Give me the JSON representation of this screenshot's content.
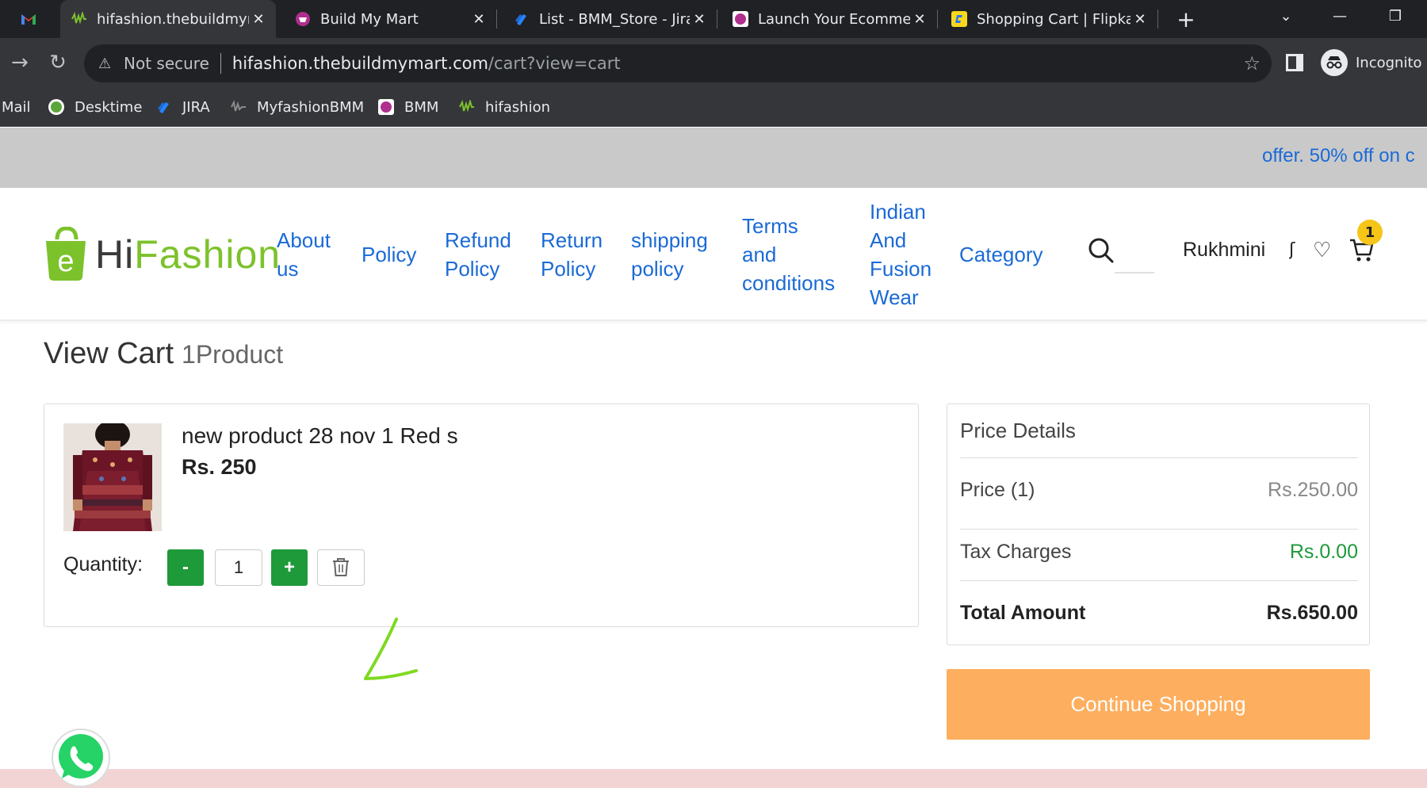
{
  "browser": {
    "tabs": [
      {
        "title": "hifashion.thebuildmymart.com",
        "active": true
      },
      {
        "title": "Build My Mart",
        "active": false
      },
      {
        "title": "List - BMM_Store - Jira",
        "active": false
      },
      {
        "title": "Launch Your Ecommerce",
        "active": false
      },
      {
        "title": "Shopping Cart | Flipkart",
        "active": false
      }
    ],
    "omnibox": {
      "security": "Not secure",
      "host": "hifashion.thebuildmymart.com",
      "path": "/cart?view=cart"
    },
    "profile_label": "Incognito",
    "bookmarks": [
      "Mail",
      "Desktime",
      "JIRA",
      "MyfashionBMM",
      "BMM",
      "hifashion"
    ]
  },
  "site": {
    "offer_text": "offer. 50% off on c",
    "logo": {
      "hi": "Hi",
      "fashion": "Fashion"
    },
    "nav": [
      {
        "lines": [
          "About",
          "us"
        ]
      },
      {
        "lines": [
          "Policy"
        ]
      },
      {
        "lines": [
          "Refund",
          "Policy"
        ]
      },
      {
        "lines": [
          "Return",
          "Policy"
        ]
      },
      {
        "lines": [
          "shipping",
          "policy"
        ]
      },
      {
        "lines": [
          "Terms",
          "and",
          "conditions"
        ]
      },
      {
        "lines": [
          "Indian",
          "And",
          "Fusion",
          "Wear"
        ]
      },
      {
        "lines": [
          "Category"
        ]
      }
    ],
    "user_name": "Rukhmini",
    "cart_count": "1"
  },
  "cart": {
    "heading": "View Cart",
    "product_count": "1Product",
    "item": {
      "name": "new product 28 nov 1 Red s",
      "price": "Rs. 250",
      "quantity_label": "Quantity:",
      "quantity": "1",
      "minus": "-",
      "plus": "+"
    }
  },
  "price_details": {
    "heading": "Price Details",
    "price_label": "Price (1)",
    "price_value": "Rs.250.00",
    "tax_label": "Tax Charges",
    "tax_value": "Rs.0.00",
    "total_label": "Total Amount",
    "total_value": "Rs.650.00"
  },
  "continue_shopping": "Continue Shopping",
  "colors": {
    "link_blue": "#1a6ad6",
    "brand_green": "#7cc22b",
    "button_green": "#1e9a3a",
    "continue_orange": "#fdae5e",
    "tax_green": "#1e9a3a"
  }
}
